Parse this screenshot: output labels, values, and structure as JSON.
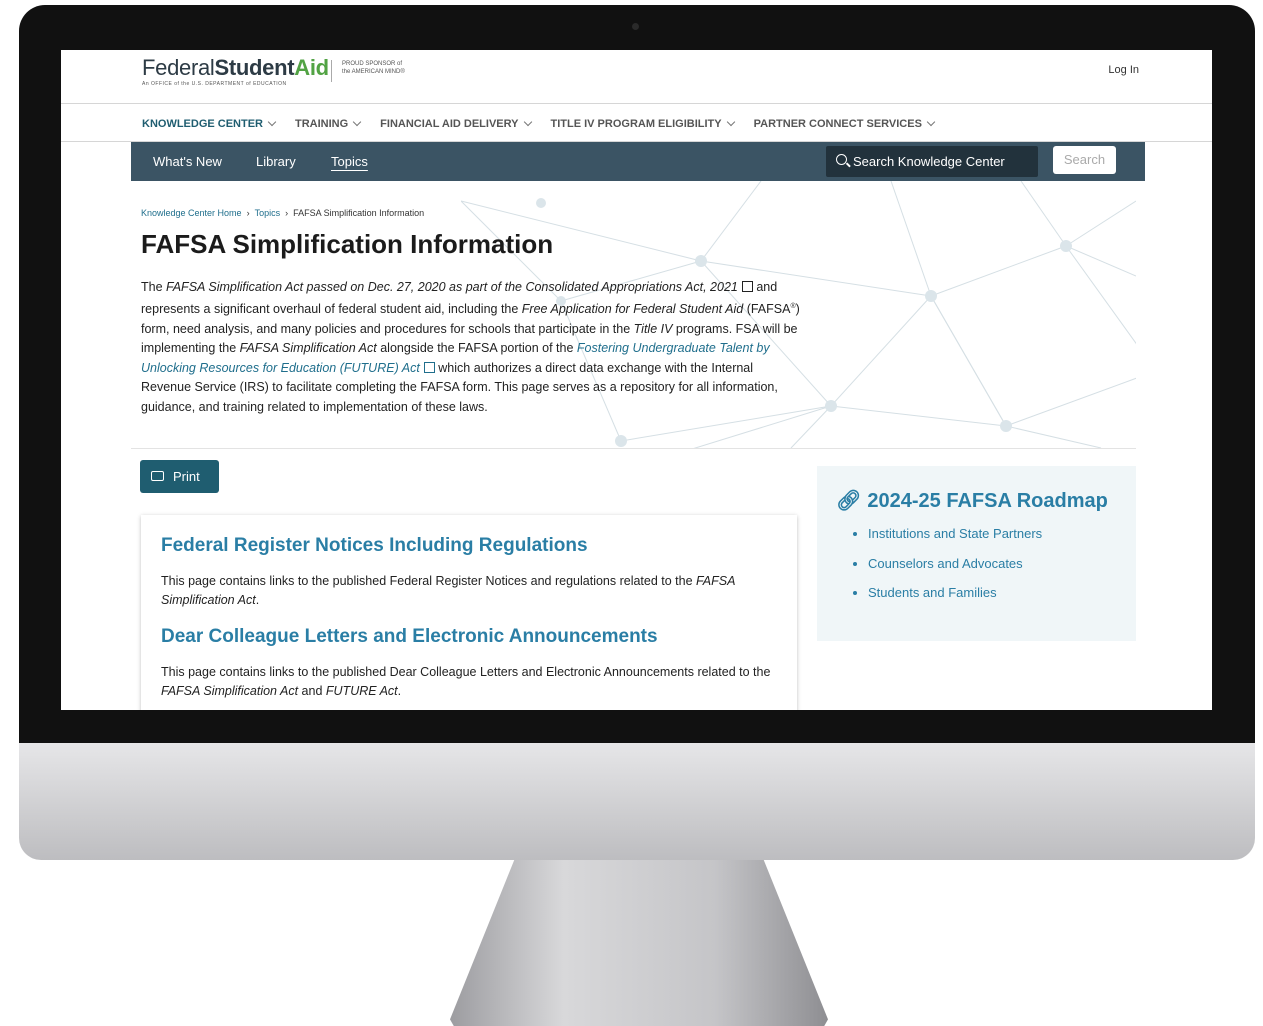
{
  "header": {
    "logo_federal": "Federal",
    "logo_student": "Student",
    "logo_aid": "Aid",
    "logo_tagline": "An OFFICE of the U.S. DEPARTMENT of EDUCATION",
    "sponsor_line1": "PROUD SPONSOR of",
    "sponsor_line2": "the AMERICAN MIND®",
    "login": "Log In"
  },
  "main_nav": [
    {
      "label": "KNOWLEDGE CENTER"
    },
    {
      "label": "TRAINING"
    },
    {
      "label": "FINANCIAL AID DELIVERY"
    },
    {
      "label": "TITLE IV PROGRAM ELIGIBILITY"
    },
    {
      "label": "PARTNER CONNECT SERVICES"
    }
  ],
  "sub_nav": {
    "items": [
      "What's New",
      "Library",
      "Topics"
    ],
    "active": "Topics",
    "search_placeholder": "Search Knowledge Center",
    "search_button": "Search"
  },
  "breadcrumb": {
    "home": "Knowledge Center Home",
    "topics": "Topics",
    "current": "FAFSA Simplification Information"
  },
  "page": {
    "title": "FAFSA Simplification Information",
    "intro": {
      "t1": "The ",
      "link1": "FAFSA Simplification Act passed on Dec. 27, 2020 as part of the Consolidated Appropriations Act, 2021",
      "t2": " and represents a significant overhaul of federal student aid, including the ",
      "i1": "Free Application for Federal Student Aid",
      "t3": " (FAFSA",
      "sup": "®",
      "t4": ") form, need analysis, and many policies and procedures for schools that participate in the ",
      "i2": "Title IV",
      "t5": " programs. FSA will be implementing the ",
      "i3": "FAFSA Simplification Act",
      "t6": " alongside the FAFSA portion of the ",
      "link2": "Fostering Undergraduate Talent by Unlocking Resources for Education (FUTURE) Act",
      "t7": " which authorizes a direct data exchange with the Internal Revenue Service (IRS) to facilitate completing the FAFSA form. This page serves as a repository for all information, guidance, and training related to implementation of these laws."
    },
    "print_label": "Print"
  },
  "cards": [
    {
      "title": "Federal Register Notices Including Regulations",
      "desc": "This page contains links to the published Federal Register Notices and regulations related to the ",
      "desc_italic": "FAFSA Simplification Act",
      "desc_end": "."
    },
    {
      "title": "Dear Colleague Letters and Electronic Announcements",
      "desc": "This page contains links to the published Dear Colleague Letters and Electronic Announcements related to the ",
      "desc_italic": "FAFSA Simplification Act",
      "desc_mid": " and ",
      "desc_italic2": "FUTURE Act",
      "desc_end": "."
    }
  ],
  "roadmap": {
    "title": "2024-25 FAFSA Roadmap",
    "items": [
      "Institutions and State Partners",
      "Counselors and Advocates",
      "Students and Families"
    ]
  },
  "colors": {
    "accent": "#2a7ea5",
    "subnav_bg": "#3b5464",
    "print_bg": "#1f5d70",
    "brand_green": "#52a344"
  }
}
